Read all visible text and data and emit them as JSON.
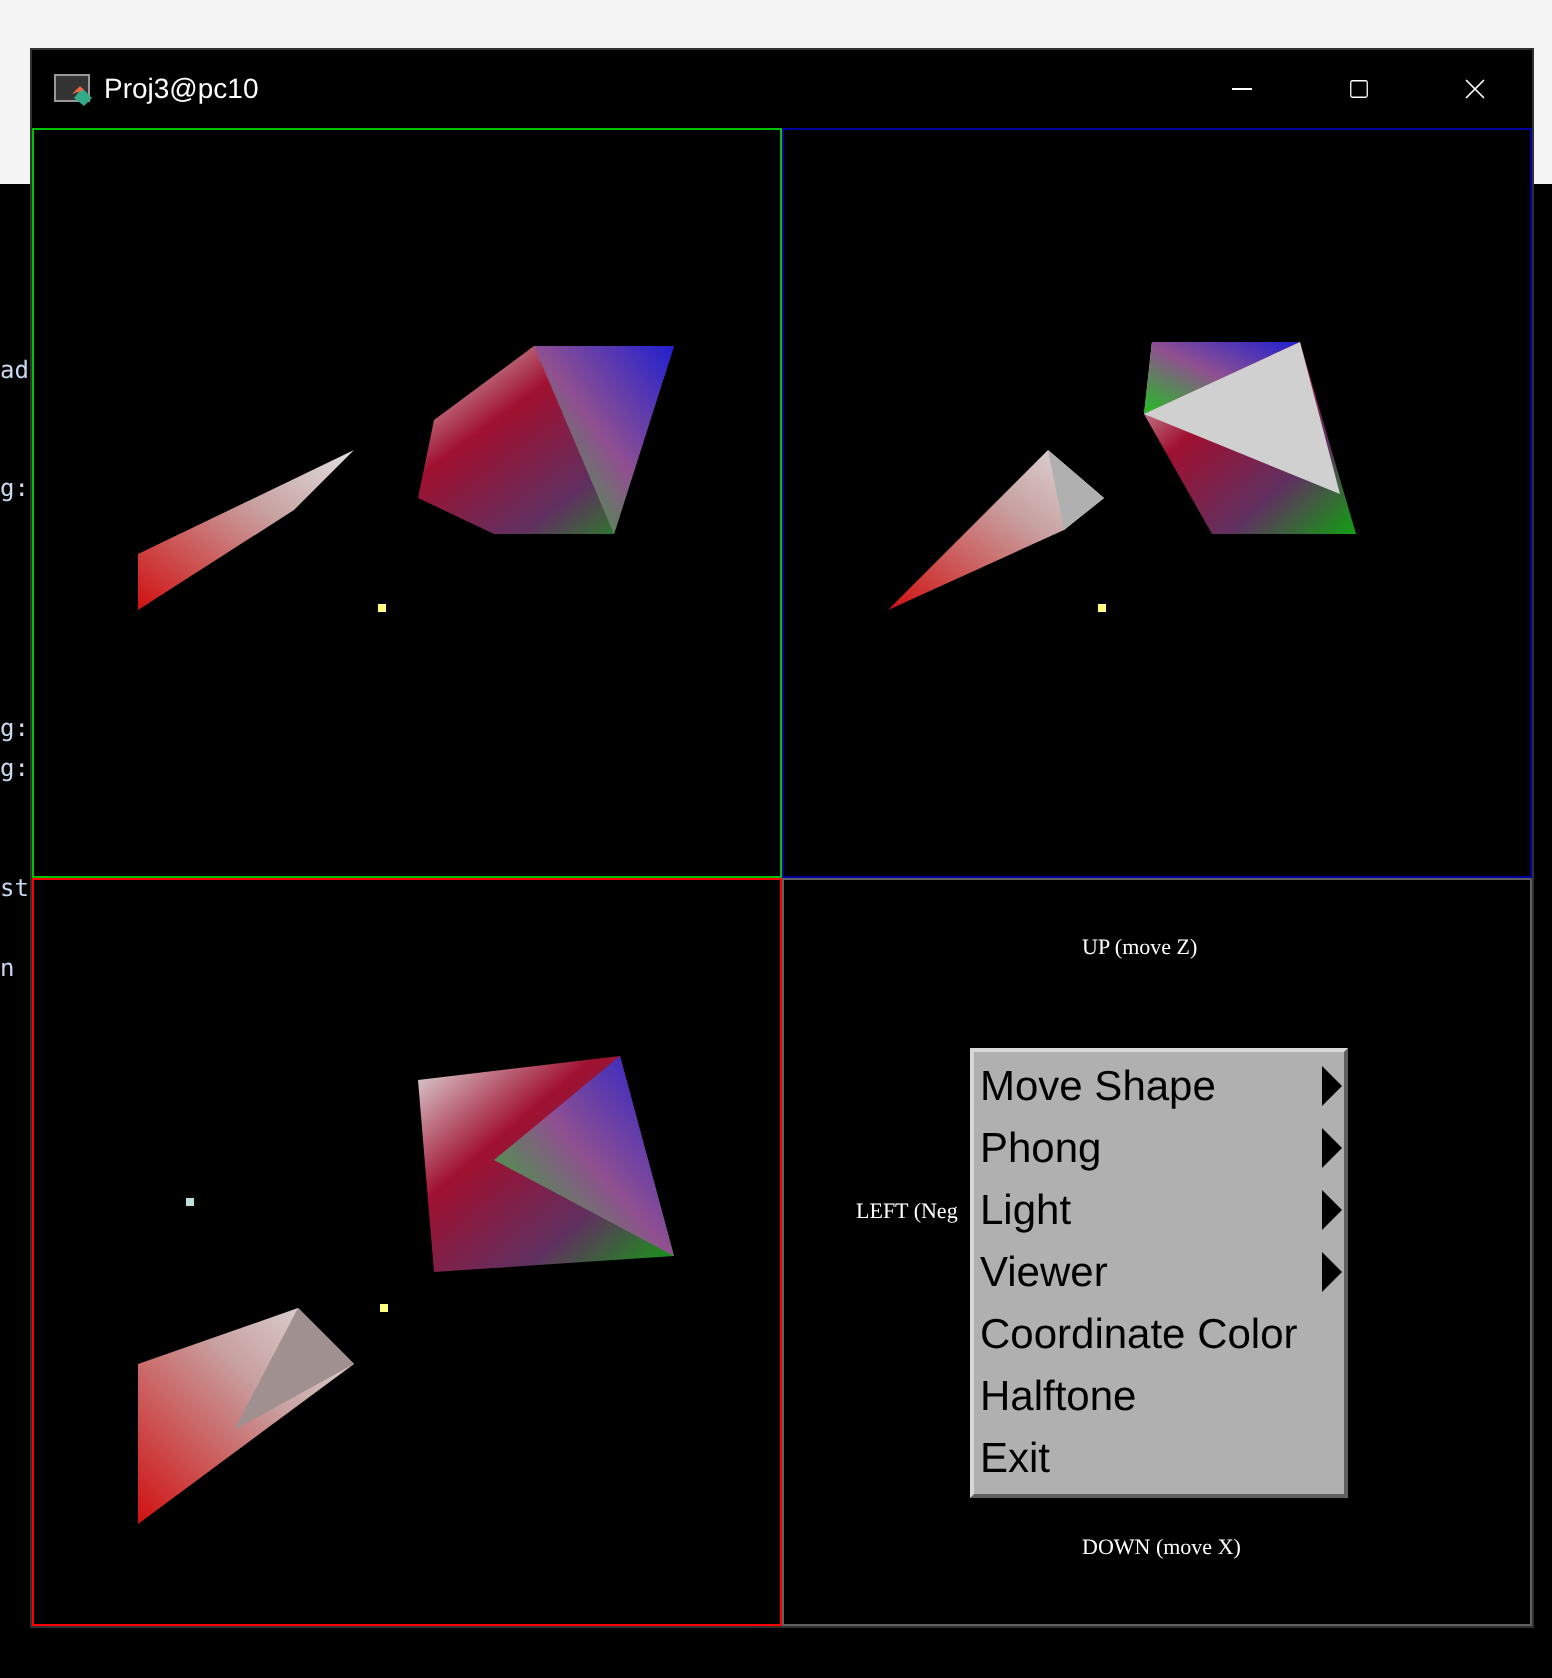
{
  "background_text_fragments": [
    "ad",
    "g:",
    "g:",
    "g:",
    "st",
    "n"
  ],
  "window": {
    "title": "Proj3@pc10"
  },
  "viewports": [
    {
      "color": "#00c000"
    },
    {
      "color": "#0000a0"
    },
    {
      "color": "#ff0000"
    },
    {
      "color": "#606060"
    }
  ],
  "control_hints": {
    "up": "UP (move Z)",
    "left": "LEFT (Neg",
    "down": "DOWN (move X)"
  },
  "context_menu": {
    "items": [
      {
        "label": "Move Shape",
        "kind": "submenu"
      },
      {
        "label": "Phong",
        "kind": "submenu"
      },
      {
        "label": "Light",
        "kind": "submenu"
      },
      {
        "label": "Viewer",
        "kind": "submenu"
      },
      {
        "label": "Coordinate Color",
        "kind": "action"
      },
      {
        "label": "Halftone",
        "kind": "action"
      },
      {
        "label": "Exit",
        "kind": "action"
      }
    ]
  }
}
